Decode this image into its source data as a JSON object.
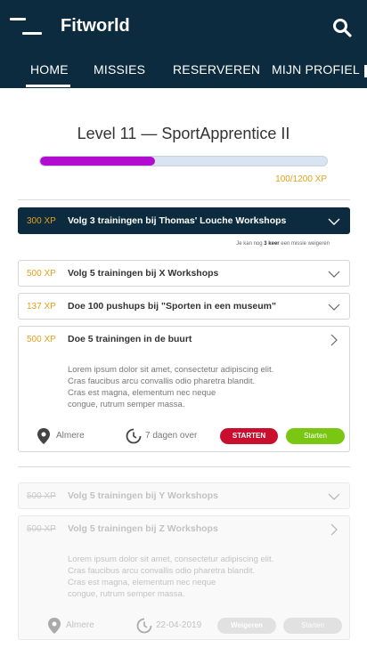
{
  "header": {
    "title": "Fitworld",
    "tabs": [
      {
        "label": "HOME"
      },
      {
        "label": "MISSIES"
      },
      {
        "label": "RESERVEREN"
      },
      {
        "label": "MIJN PROFIEL"
      }
    ]
  },
  "level": {
    "title": "Level 11 — SportApprentice II",
    "progress_fraction": 0.4,
    "xp_text": "100/1200 XP"
  },
  "active_mission": {
    "xp": "300 XP",
    "title": "Volg 3 trainingen bij Thomas' Louche Workshops"
  },
  "refusal_note": {
    "prefix": "Je kan nog",
    "count": "3 keer",
    "suffix": "een missie weigeren"
  },
  "missions": [
    {
      "xp": "500 XP",
      "title": "Volg 5 trainingen bij X Workshops"
    },
    {
      "xp": "137 XP",
      "title": "Doe 100 pushups bij \"Sporten in een museum\""
    },
    {
      "xp": "500 XP",
      "title": "Doe 5 trainingen in de buurt",
      "description": [
        "Lorem ipsum dolor sit amet, consectetur adipiscing elit.",
        "Cras faucibus arcu convallis odio pharetra blandit.",
        "Cras est magna, elementum nec neque",
        "congue, rutrum semper massa."
      ],
      "location": "Almere",
      "time_left": "7 dagen over",
      "refuse_label": "STARTEN",
      "start_label": "Starten"
    }
  ],
  "disabled_missions": [
    {
      "xp": "500 XP",
      "title": "Volg 5 trainingen bij Y Workshops"
    },
    {
      "xp": "500 XP",
      "title": "Volg 5 trainingen bij Z Workshops",
      "description": [
        "Lorem ipsum dolor sit amet, consectetur adipiscing elit.",
        "Cras faucibus arcu convallis odio pharetra blandit.",
        "Cras est magna, elementum nec neque",
        "congue, rutrum semper massa."
      ],
      "location": "Almere",
      "date": "22-04-2019",
      "refuse_label": "Weigeren",
      "start_label": "Starten"
    }
  ],
  "colors": {
    "header_bg": "#0d2b3e",
    "progress_fill": "#b10ccf",
    "xp_gold": "#e3a01b",
    "refuse_red": "#c8102e",
    "start_green": "#7ac713"
  },
  "icons": [
    "menu-icon",
    "search-icon",
    "chevron-down-icon",
    "chevron-right-icon",
    "location-pin-icon",
    "clock-icon"
  ]
}
